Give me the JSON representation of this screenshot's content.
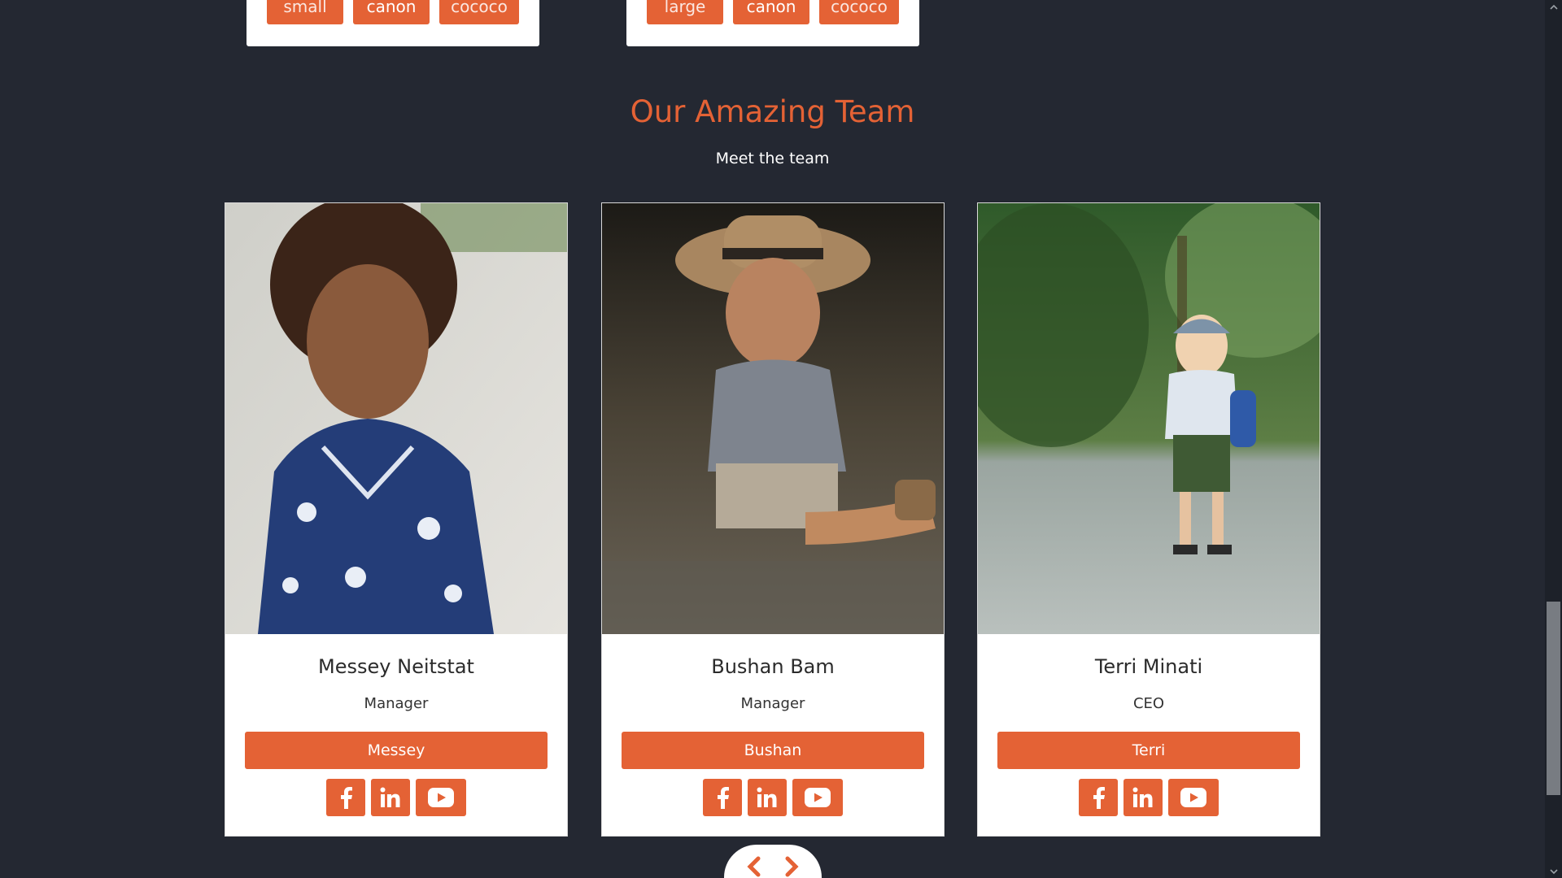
{
  "top_cards": [
    {
      "tags": [
        "small",
        "canon",
        "cococo"
      ]
    },
    {
      "tags": [
        "large",
        "canon",
        "cococo"
      ]
    }
  ],
  "team": {
    "title": "Our Amazing Team",
    "subtitle": "Meet the team",
    "members": [
      {
        "name": "Messey Neitstat",
        "role": "Manager",
        "button": "Messey"
      },
      {
        "name": "Bushan Bam",
        "role": "Manager",
        "button": "Bushan"
      },
      {
        "name": "Terri Minati",
        "role": "CEO",
        "button": "Terri"
      }
    ]
  },
  "colors": {
    "background": "#242832",
    "accent": "#e46235",
    "card": "#ffffff"
  },
  "icons": [
    "facebook-icon",
    "linkedin-icon",
    "youtube-icon",
    "chevron-left-icon",
    "chevron-right-icon"
  ]
}
